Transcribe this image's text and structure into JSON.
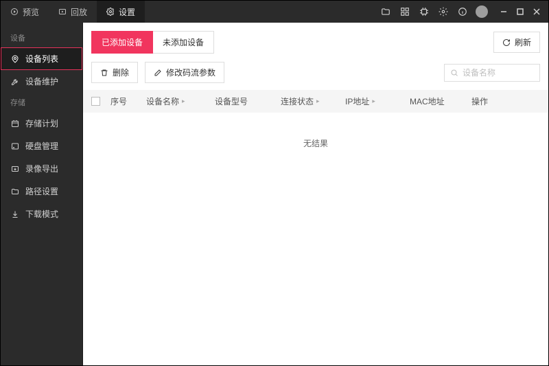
{
  "topTabs": {
    "preview": "预览",
    "playback": "回放",
    "settings": "设置"
  },
  "sidebar": {
    "sections": {
      "device": {
        "title": "设备",
        "items": [
          "设备列表",
          "设备维护"
        ]
      },
      "storage": {
        "title": "存储",
        "items": [
          "存储计划",
          "硬盘管理",
          "录像导出",
          "路径设置",
          "下载模式"
        ]
      }
    }
  },
  "innerTabs": {
    "added": "已添加设备",
    "notAdded": "未添加设备"
  },
  "buttons": {
    "refresh": "刷新",
    "delete": "删除",
    "modifyStream": "修改码流参数"
  },
  "search": {
    "placeholder": "设备名称"
  },
  "columns": {
    "index": "序号",
    "name": "设备名称",
    "model": "设备型号",
    "conn": "连接状态",
    "ip": "IP地址",
    "mac": "MAC地址",
    "op": "操作"
  },
  "noResult": "无结果"
}
